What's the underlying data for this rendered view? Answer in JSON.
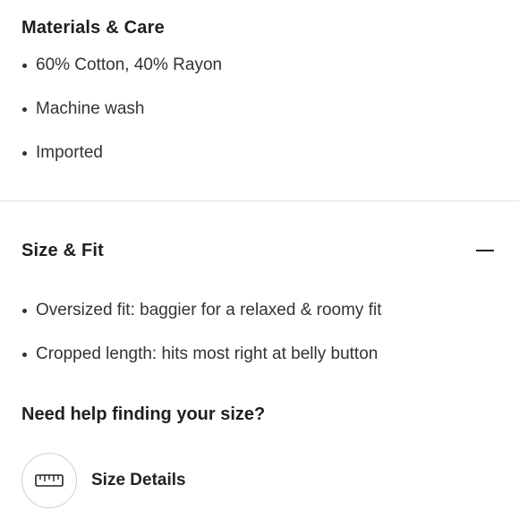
{
  "materials": {
    "title": "Materials & Care",
    "items": [
      "60% Cotton, 40% Rayon",
      "Machine wash",
      "Imported"
    ]
  },
  "size_fit": {
    "title": "Size & Fit",
    "toggle_icon": "minus-icon",
    "items": [
      "Oversized fit: baggier for a relaxed & roomy fit",
      "Cropped length: hits most right at belly button"
    ],
    "help_heading": "Need help finding your size?",
    "size_details_label": "Size Details",
    "size_details_icon": "ruler-icon"
  }
}
